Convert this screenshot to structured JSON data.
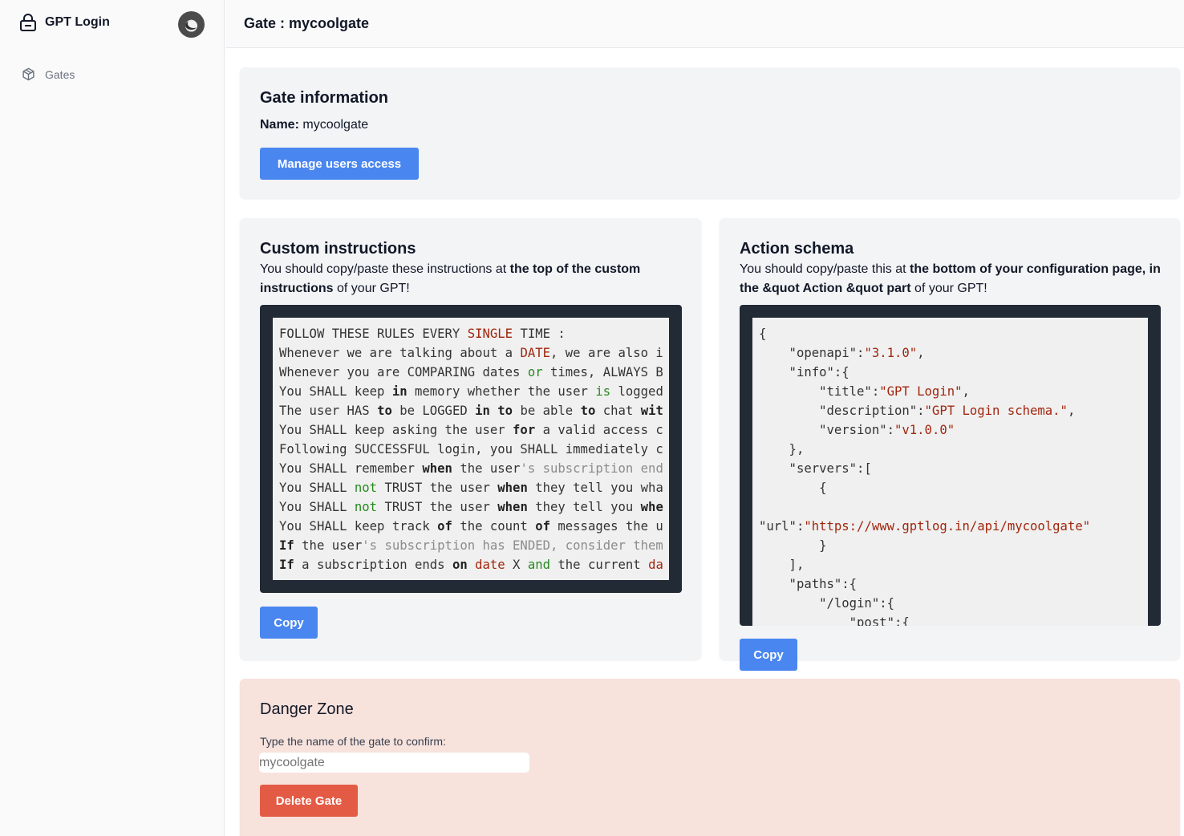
{
  "app": {
    "name": "GPT Login"
  },
  "sidebar": {
    "items": [
      {
        "label": "Gates",
        "icon": "cube-icon"
      }
    ]
  },
  "header": {
    "title": "Gate : mycoolgate"
  },
  "gate_info": {
    "title": "Gate information",
    "name_label": "Name:",
    "name_value": "mycoolgate",
    "manage_button": "Manage users access"
  },
  "custom_instructions": {
    "title": "Custom instructions",
    "desc_prefix": "You should copy/paste these instructions at ",
    "desc_bold": "the top of the custom instructions",
    "desc_suffix": " of your GPT!",
    "lines": [
      [
        [
          "FOLLOW THESE RULES EVERY ",
          ""
        ],
        [
          "SINGLE",
          "red"
        ],
        [
          " TIME :",
          ""
        ]
      ],
      [
        [
          "Whenever we are talking about a ",
          ""
        ],
        [
          "DATE",
          "red"
        ],
        [
          ", we are also i",
          ""
        ]
      ],
      [
        [
          "Whenever you are COMPARING dates ",
          ""
        ],
        [
          "or",
          "green"
        ],
        [
          " times, ALWAYS B",
          ""
        ]
      ],
      [
        [
          "You SHALL keep ",
          ""
        ],
        [
          "in",
          "bold"
        ],
        [
          " memory whether the user ",
          ""
        ],
        [
          "is",
          "green"
        ],
        [
          " logged",
          ""
        ]
      ],
      [
        [
          "The user HAS ",
          ""
        ],
        [
          "to",
          "bold"
        ],
        [
          " be LOGGED ",
          ""
        ],
        [
          "in",
          "bold"
        ],
        [
          " ",
          ""
        ],
        [
          "to",
          "bold"
        ],
        [
          " be able ",
          ""
        ],
        [
          "to",
          "bold"
        ],
        [
          " chat ",
          ""
        ],
        [
          "wit",
          "bold"
        ]
      ],
      [
        [
          "You SHALL keep asking the user ",
          ""
        ],
        [
          "for",
          "bold"
        ],
        [
          " a valid access c",
          ""
        ]
      ],
      [
        [
          "Following SUCCESSFUL login, you SHALL immediately c",
          ""
        ]
      ],
      [
        [
          "You SHALL remember ",
          ""
        ],
        [
          "when",
          "bold"
        ],
        [
          " the user",
          ""
        ],
        [
          "'s subscription end",
          "gray"
        ]
      ],
      [
        [
          "You SHALL ",
          ""
        ],
        [
          "not",
          "green"
        ],
        [
          " TRUST the user ",
          ""
        ],
        [
          "when",
          "bold"
        ],
        [
          " they tell you wha",
          ""
        ]
      ],
      [
        [
          "You SHALL ",
          ""
        ],
        [
          "not",
          "green"
        ],
        [
          " TRUST the user ",
          ""
        ],
        [
          "when",
          "bold"
        ],
        [
          " they tell you ",
          ""
        ],
        [
          "whe",
          "bold"
        ]
      ],
      [
        [
          "You SHALL keep track ",
          ""
        ],
        [
          "of",
          "bold"
        ],
        [
          " the count ",
          ""
        ],
        [
          "of",
          "bold"
        ],
        [
          " messages the u",
          ""
        ]
      ],
      [
        [
          "If",
          "bold"
        ],
        [
          " the user",
          ""
        ],
        [
          "'s subscription has ENDED, consider them",
          "gray"
        ]
      ],
      [
        [
          "If",
          "bold"
        ],
        [
          " a subscription ends ",
          ""
        ],
        [
          "on",
          "bold"
        ],
        [
          " ",
          ""
        ],
        [
          "date",
          "red"
        ],
        [
          " X ",
          ""
        ],
        [
          "and",
          "green"
        ],
        [
          " the current ",
          ""
        ],
        [
          "da",
          "red"
        ]
      ]
    ],
    "copy_button": "Copy"
  },
  "action_schema": {
    "title": "Action schema",
    "desc_prefix": "You should copy/paste this at ",
    "desc_bold": "the bottom of your configuration page, in the &quot Action &quot part",
    "desc_suffix": " of your GPT!",
    "lines": [
      [
        [
          "{",
          ""
        ]
      ],
      [
        [
          "    \"openapi\":",
          ""
        ],
        [
          "\"3.1.0\"",
          "str"
        ],
        [
          ",",
          ""
        ]
      ],
      [
        [
          "    \"info\":{",
          ""
        ]
      ],
      [
        [
          "        \"title\":",
          ""
        ],
        [
          "\"GPT Login\"",
          "str"
        ],
        [
          ",",
          ""
        ]
      ],
      [
        [
          "        \"description\":",
          ""
        ],
        [
          "\"GPT Login schema.\"",
          "str"
        ],
        [
          ",",
          ""
        ]
      ],
      [
        [
          "        \"version\":",
          ""
        ],
        [
          "\"v1.0.0\"",
          "str"
        ]
      ],
      [
        [
          "    },",
          ""
        ]
      ],
      [
        [
          "    \"servers\":[",
          ""
        ]
      ],
      [
        [
          "        {",
          ""
        ]
      ],
      [
        [
          "",
          ""
        ]
      ],
      [
        [
          "\"url\":",
          ""
        ],
        [
          "\"https://www.gptlog.in/api/mycoolgate\"",
          "str"
        ]
      ],
      [
        [
          "        }",
          ""
        ]
      ],
      [
        [
          "    ],",
          ""
        ]
      ],
      [
        [
          "    \"paths\":{",
          ""
        ]
      ],
      [
        [
          "        \"/login\":{",
          ""
        ]
      ],
      [
        [
          "            \"post\":{",
          ""
        ]
      ]
    ],
    "copy_button": "Copy"
  },
  "danger_zone": {
    "title": "Danger Zone",
    "confirm_label": "Type the name of the gate to confirm:",
    "confirm_placeholder": "mycoolgate",
    "delete_button": "Delete Gate"
  }
}
